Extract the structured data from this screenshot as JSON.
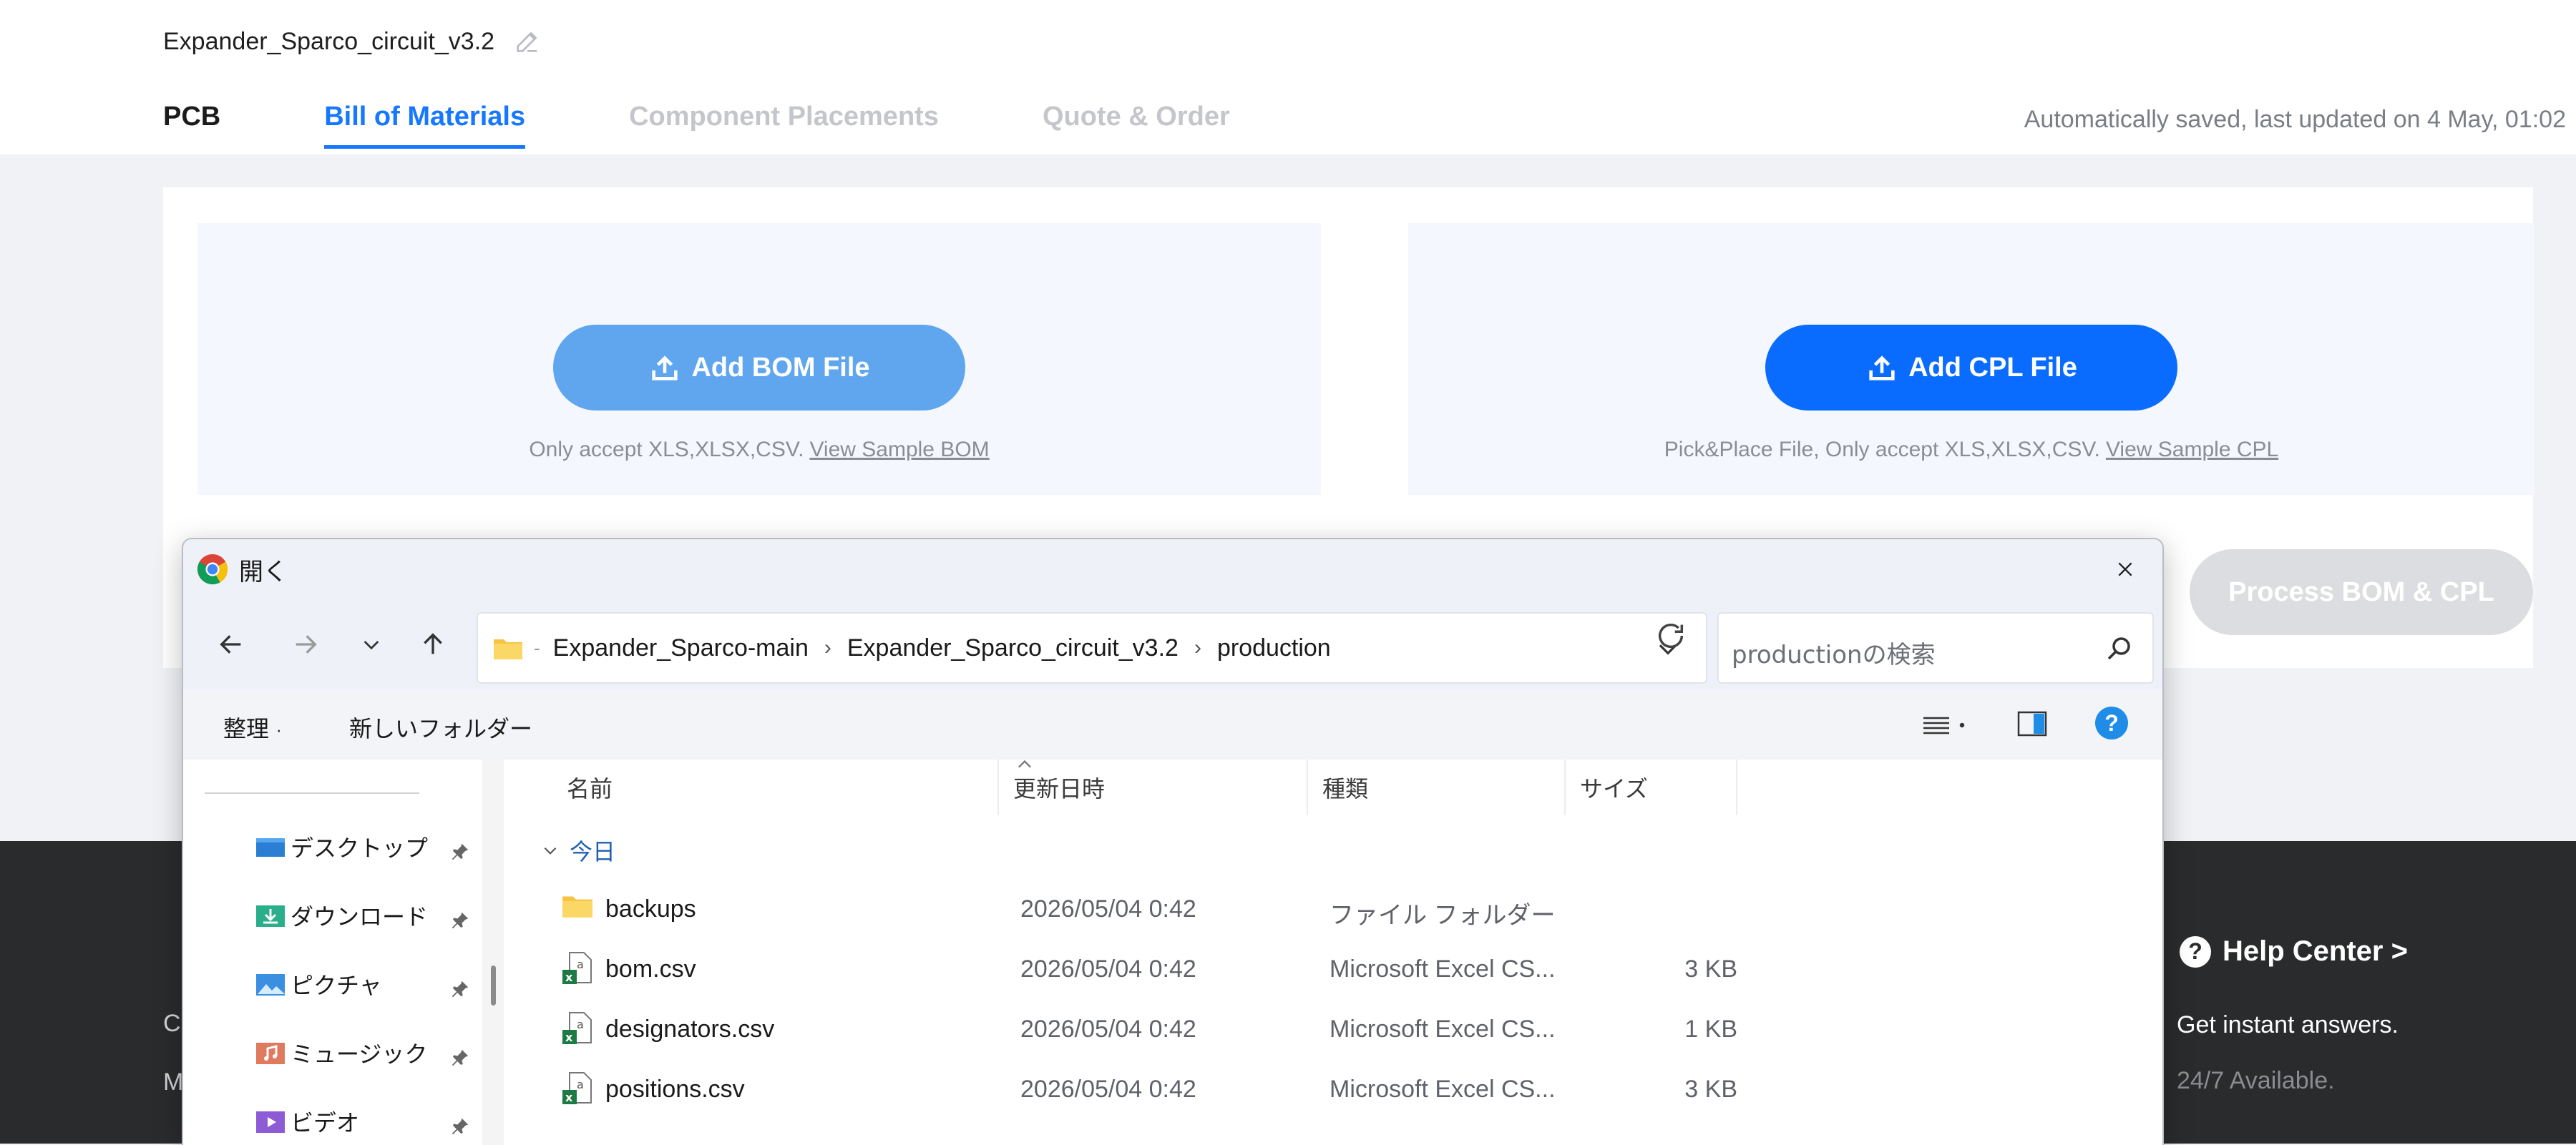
{
  "header": {
    "project_title": "Expander_Sparco_circuit_v3.2",
    "tabs": [
      "PCB",
      "Bill of Materials",
      "Component Placements",
      "Quote & Order"
    ],
    "active_tab": "Bill of Materials",
    "autosave": "Automatically saved, last updated on 4 May, 01:02"
  },
  "upload": {
    "bom_button": "Add BOM File",
    "bom_hint": "Only accept XLS,XLSX,CSV.",
    "bom_link": "View Sample BOM",
    "cpl_button": "Add CPL File",
    "cpl_hint": "Pick&Place File, Only accept XLS,XLSX,CSV.",
    "cpl_link": "View Sample CPL",
    "process_button": "Process BOM & CPL"
  },
  "footer": {
    "left_1": "C",
    "left_2": "M",
    "help_title": "Help Center >",
    "help_sub": "Get instant answers.",
    "help_sub2": "24/7 Available."
  },
  "dialog": {
    "title": "開く",
    "breadcrumb": [
      "Expander_Sparco-main",
      "Expander_Sparco_circuit_v3.2",
      "production"
    ],
    "search_placeholder": "productionの検索",
    "toolbar": {
      "organize": "整理",
      "new_folder": "新しいフォルダー"
    },
    "sidebar": [
      {
        "label": "デスクトップ",
        "icon": "desktop-icon"
      },
      {
        "label": "ダウンロード",
        "icon": "download-icon"
      },
      {
        "label": "ピクチャ",
        "icon": "pictures-icon"
      },
      {
        "label": "ミュージック",
        "icon": "music-icon"
      },
      {
        "label": "ビデオ",
        "icon": "video-icon"
      }
    ],
    "columns": [
      "名前",
      "更新日時",
      "種類",
      "サイズ"
    ],
    "group": "今日",
    "files": [
      {
        "name": "backups",
        "date": "2026/05/04 0:42",
        "type": "ファイル フォルダー",
        "size": "",
        "icon": "folder-icon"
      },
      {
        "name": "bom.csv",
        "date": "2026/05/04 0:42",
        "type": "Microsoft Excel CS...",
        "size": "3 KB",
        "icon": "excel-csv-icon"
      },
      {
        "name": "designators.csv",
        "date": "2026/05/04 0:42",
        "type": "Microsoft Excel CS...",
        "size": "1 KB",
        "icon": "excel-csv-icon"
      },
      {
        "name": "positions.csv",
        "date": "2026/05/04 0:42",
        "type": "Microsoft Excel CS...",
        "size": "3 KB",
        "icon": "excel-csv-icon"
      }
    ]
  },
  "colors": {
    "accent": "#1677ff",
    "bom_button": "#5fa6ef",
    "cpl_button": "#0a6cff",
    "footer": "#2a2b2d"
  }
}
